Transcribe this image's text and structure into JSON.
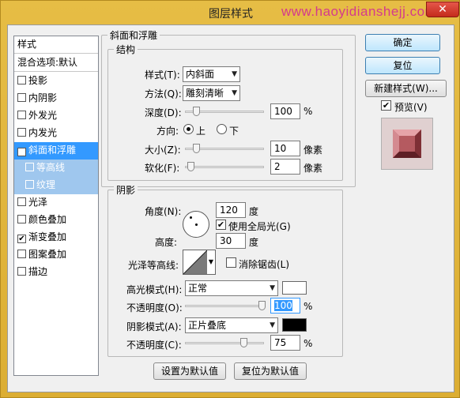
{
  "window": {
    "title": "图层样式",
    "watermark": "www.haoyidianshejj.com",
    "close": "✕"
  },
  "left_list": {
    "header": "样式",
    "blend": "混合选项:默认",
    "items": [
      {
        "label": "投影",
        "checked": false
      },
      {
        "label": "内阴影",
        "checked": false
      },
      {
        "label": "外发光",
        "checked": false
      },
      {
        "label": "内发光",
        "checked": false
      },
      {
        "label": "斜面和浮雕",
        "checked": true
      },
      {
        "label": "等高线",
        "checked": false
      },
      {
        "label": "纹理",
        "checked": false
      },
      {
        "label": "光泽",
        "checked": false
      },
      {
        "label": "颜色叠加",
        "checked": false
      },
      {
        "label": "渐变叠加",
        "checked": true
      },
      {
        "label": "图案叠加",
        "checked": false
      },
      {
        "label": "描边",
        "checked": false
      }
    ]
  },
  "bevel": {
    "group_title": "斜面和浮雕",
    "structure_title": "结构",
    "style_label": "样式(T):",
    "style_value": "内斜面",
    "technique_label": "方法(Q):",
    "technique_value": "雕刻清晰",
    "depth_label": "深度(D):",
    "depth_value": "100",
    "depth_unit": "%",
    "direction_label": "方向:",
    "direction_up": "上",
    "direction_down": "下",
    "size_label": "大小(Z):",
    "size_value": "10",
    "size_unit": "像素",
    "soften_label": "软化(F):",
    "soften_value": "2",
    "soften_unit": "像素"
  },
  "shading": {
    "group_title": "阴影",
    "angle_label": "角度(N):",
    "angle_value": "120",
    "angle_unit": "度",
    "global_light_label": "使用全局光(G)",
    "altitude_label": "高度:",
    "altitude_value": "30",
    "altitude_unit": "度",
    "gloss_label": "光泽等高线:",
    "antialias_label": "消除锯齿(L)",
    "highlight_mode_label": "高光模式(H):",
    "highlight_mode_value": "正常",
    "highlight_color": "#ffffff",
    "highlight_opacity_label": "不透明度(O):",
    "highlight_opacity_value": "100",
    "highlight_opacity_unit": "%",
    "shadow_mode_label": "阴影模式(A):",
    "shadow_mode_value": "正片叠底",
    "shadow_color": "#000000",
    "shadow_opacity_label": "不透明度(C):",
    "shadow_opacity_value": "75",
    "shadow_opacity_unit": "%"
  },
  "bottom": {
    "make_default": "设置为默认值",
    "reset_default": "复位为默认值"
  },
  "right": {
    "ok": "确定",
    "reset": "复位",
    "new_style": "新建样式(W)...",
    "preview_label": "预览(V)"
  },
  "levels": {
    "depth": 0.1,
    "size": 0.1,
    "soften": 0.02,
    "highlight_opacity": 1.0,
    "shadow_opacity": 0.75
  }
}
